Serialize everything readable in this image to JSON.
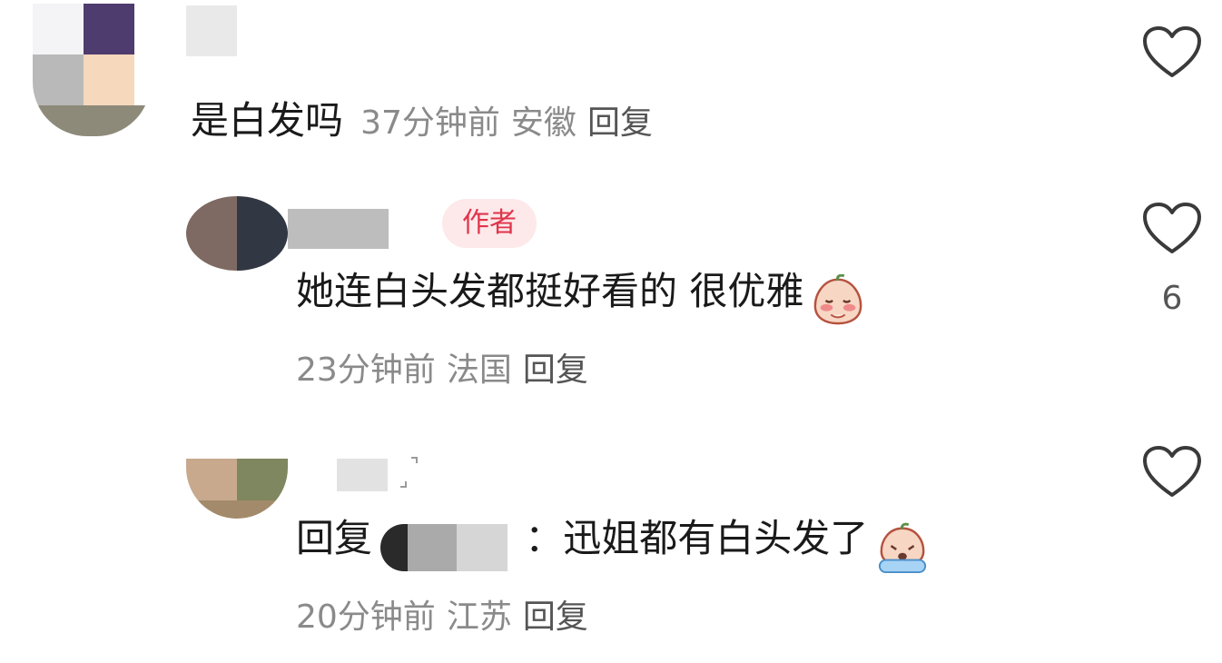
{
  "colors": {
    "author_tag_bg": "#fde8ea",
    "author_tag_text": "#e0344a",
    "meta": "#8a8a8a"
  },
  "comments": [
    {
      "text": "是白发吗",
      "time": "37分钟前",
      "location": "安徽",
      "reply": "回复",
      "liked": false
    },
    {
      "author_tag": "作者",
      "text": "她连白头发都挺好看的 很优雅",
      "emoji": "shy-face-emoji",
      "time": "23分钟前",
      "location": "法国",
      "reply": "回复",
      "like_count": "6"
    },
    {
      "reply_prefix": "回复",
      "text": "：迅姐都有白头发了",
      "emoji": "crying-face-emoji",
      "time": "20分钟前",
      "location": "江苏",
      "reply": "回复"
    }
  ]
}
